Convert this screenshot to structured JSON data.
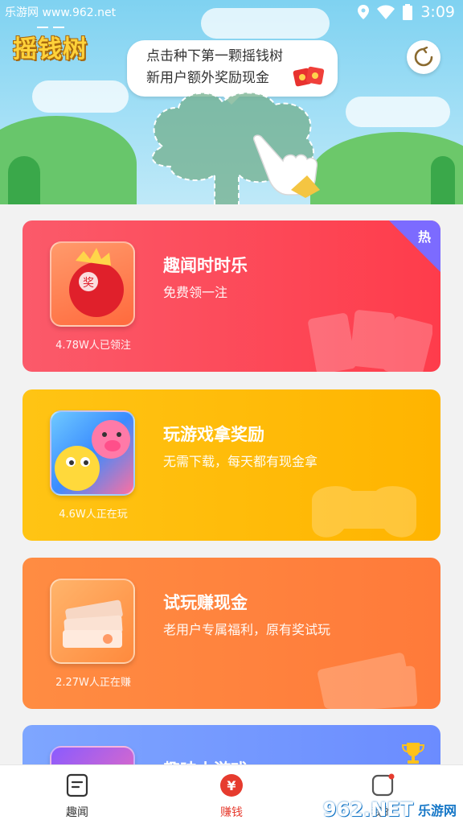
{
  "status_bar": {
    "watermark": "乐游网 www.962.net",
    "time": "3:09"
  },
  "hero": {
    "logo": "摇钱树",
    "speech_line1": "点击种下第一颗摇钱树",
    "speech_line2": "新用户额外奖励现金"
  },
  "cards": [
    {
      "title": "趣闻时时乐",
      "subtitle": "免费领一注",
      "users": "4.78W人已领注",
      "badge": "热"
    },
    {
      "title": "玩游戏拿奖励",
      "subtitle": "无需下载，每天都有现金拿",
      "users": "4.6W人正在玩"
    },
    {
      "title": "试玩赚现金",
      "subtitle": "老用户专属福利，原有奖试玩",
      "users": "2.27W人正在赚"
    },
    {
      "title": "趣味小游戏"
    }
  ],
  "bottom_nav": {
    "items": [
      {
        "label": "趣闻"
      },
      {
        "label": "赚钱",
        "icon_text": "¥"
      },
      {
        "label": "我的"
      }
    ]
  },
  "watermark_962": {
    "big": "962.NET",
    "small": "乐游网"
  },
  "colors": {
    "card1": "#fe4a59",
    "card2": "#ffbc0a",
    "card3": "#ff833e",
    "card4": "#7597ff",
    "active_nav": "#e63b2e"
  }
}
